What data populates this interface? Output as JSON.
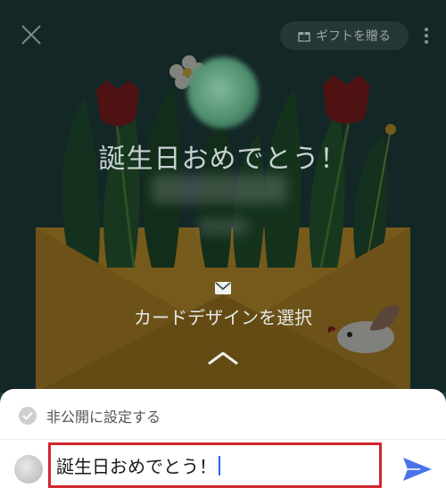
{
  "header": {
    "close_icon": "close-icon",
    "gift_button_label": "ギフトを贈る",
    "gift_icon": "gift-icon",
    "more_icon": "more-vertical-icon"
  },
  "card": {
    "greeting": "誕生日おめでとう！",
    "design_icon": "mail-icon",
    "design_label": "カードデザインを選択",
    "expand_icon": "chevron-up-icon"
  },
  "composer": {
    "private_label": "非公開に設定する",
    "private_icon": "check-circle-icon",
    "message_value": "誕生日おめでとう！",
    "send_icon": "send-icon",
    "accent_color": "#4a73e8",
    "highlight_color": "#d2262f"
  }
}
